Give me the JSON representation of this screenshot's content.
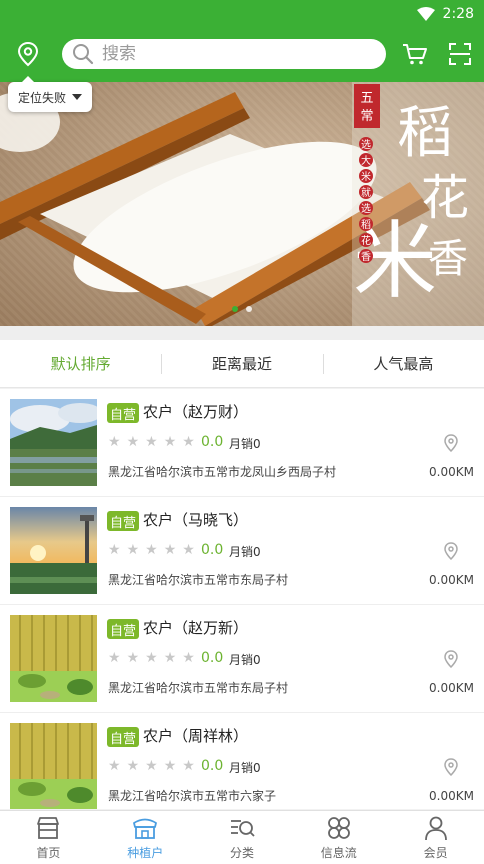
{
  "status": {
    "time": "2:28"
  },
  "header": {
    "search_placeholder": "搜索"
  },
  "location_tip": {
    "label": "定位失败"
  },
  "banner": {
    "title_chars": "稻花香米",
    "brand": "五常",
    "slogan": "选大米就选稻花香"
  },
  "sort_tabs": [
    {
      "label": "默认排序",
      "active": true
    },
    {
      "label": "距离最近",
      "active": false
    },
    {
      "label": "人气最高",
      "active": false
    }
  ],
  "farmers": [
    {
      "badge": "自营",
      "name": "农户（赵万财）",
      "score": "0.0",
      "sales": "月销0",
      "address": "黑龙江省哈尔滨市五常市龙凤山乡西局子村",
      "distance": "0.00KM",
      "thumb": "rice-field"
    },
    {
      "badge": "自营",
      "name": "农户（马晓飞）",
      "score": "0.0",
      "sales": "月销0",
      "address": "黑龙江省哈尔滨市五常市东局子村",
      "distance": "0.00KM",
      "thumb": "sunset-field"
    },
    {
      "badge": "自营",
      "name": "农户（赵万新）",
      "score": "0.0",
      "sales": "月销0",
      "address": "黑龙江省哈尔滨市五常市东局子村",
      "distance": "0.00KM",
      "thumb": "cartoon-cliff"
    },
    {
      "badge": "自营",
      "name": "农户（周祥林）",
      "score": "0.0",
      "sales": "月销0",
      "address": "黑龙江省哈尔滨市五常市六家子",
      "distance": "0.00KM",
      "thumb": "cartoon-cliff"
    }
  ],
  "bottom_nav": [
    {
      "label": "首页",
      "icon": "store-icon",
      "active": false
    },
    {
      "label": "种植户",
      "icon": "farmer-shop-icon",
      "active": true
    },
    {
      "label": "分类",
      "icon": "category-search-icon",
      "active": false
    },
    {
      "label": "信息流",
      "icon": "grid-icon",
      "active": false
    },
    {
      "label": "会员",
      "icon": "member-icon",
      "active": false
    }
  ],
  "colors": {
    "primary": "#3bb035",
    "active_tab": "#64aa32",
    "nav_active": "#4a9de0",
    "badge": "#7db82a"
  }
}
